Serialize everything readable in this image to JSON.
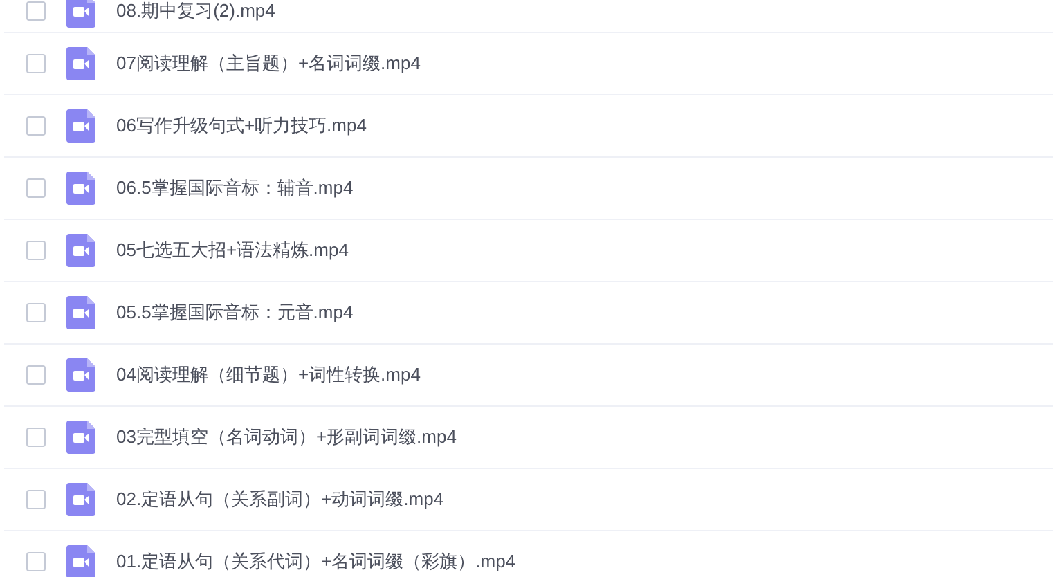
{
  "files": [
    {
      "name": "08.期中复习(2).mp4",
      "checked": false
    },
    {
      "name": "07阅读理解（主旨题）+名词词缀.mp4",
      "checked": false
    },
    {
      "name": "06写作升级句式+听力技巧.mp4",
      "checked": false
    },
    {
      "name": "06.5掌握国际音标：辅音.mp4",
      "checked": false
    },
    {
      "name": "05七选五大招+语法精炼.mp4",
      "checked": false
    },
    {
      "name": "05.5掌握国际音标：元音.mp4",
      "checked": false
    },
    {
      "name": "04阅读理解（细节题）+词性转换.mp4",
      "checked": false
    },
    {
      "name": "03完型填空（名词动词）+形副词词缀.mp4",
      "checked": false
    },
    {
      "name": "02.定语从句（关系副词）+动词词缀.mp4",
      "checked": false
    },
    {
      "name": "01.定语从句（关系代词）+名词词缀（彩旗）.mp4",
      "checked": false
    }
  ]
}
